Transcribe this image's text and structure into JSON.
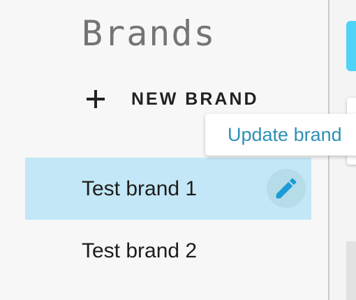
{
  "page": {
    "title": "Brands"
  },
  "toolbar": {
    "new_brand_label": "NEW BRAND",
    "new_brand_icon": "plus-icon"
  },
  "brands": {
    "items": [
      {
        "label": "Test brand 1",
        "selected": true
      },
      {
        "label": "Test brand 2",
        "selected": false
      }
    ],
    "edit_icon": "pencil-icon"
  },
  "tooltip": {
    "text": "Update brand"
  },
  "colors": {
    "accent": "#1a9ad6",
    "selected_row": "#c3e7f6",
    "tooltip_text": "#2f8fb5",
    "primary_button": "#4fd3f6"
  }
}
